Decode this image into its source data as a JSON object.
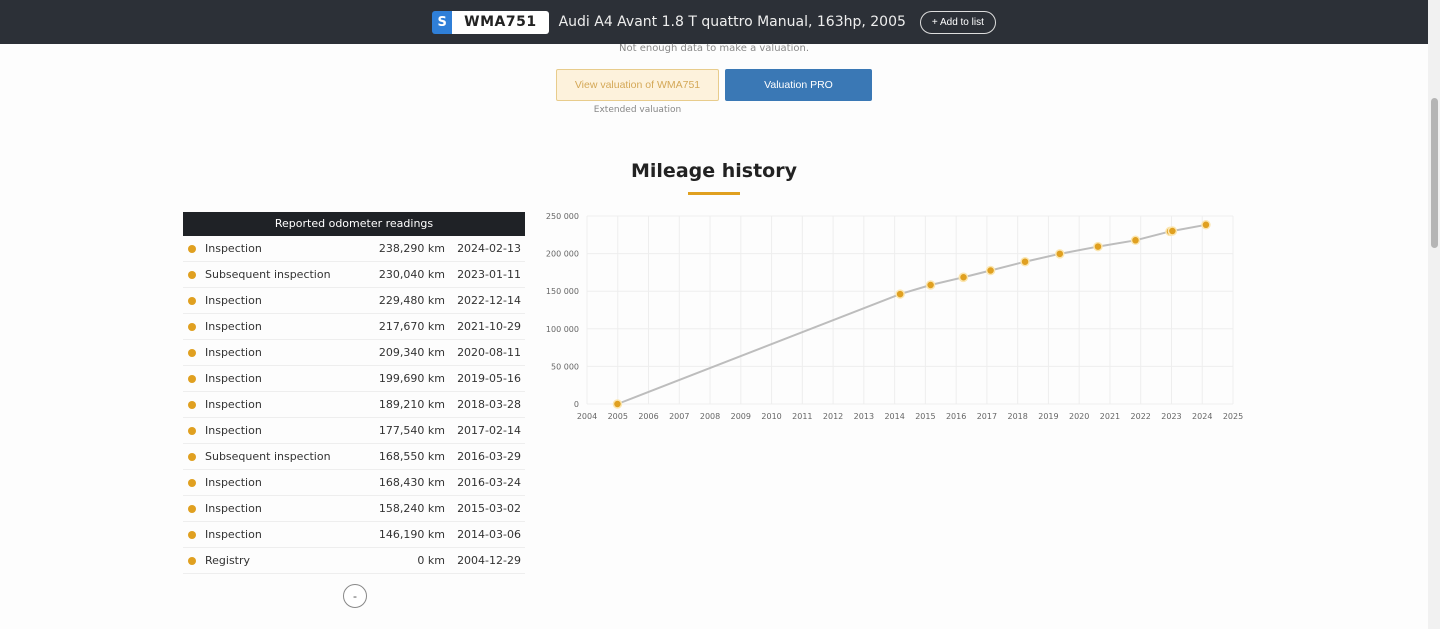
{
  "header": {
    "plate_prefix": "S",
    "plate": "WMA751",
    "title": "Audi A4 Avant 1.8 T quattro Manual, 163hp, 2005",
    "add_to_list": "+ Add to list"
  },
  "valuation": {
    "note": "Not enough data to make a valuation.",
    "view_button": "View valuation of WMA751",
    "pro_button": "Valuation PRO",
    "extended": "Extended valuation"
  },
  "section_title": "Mileage history",
  "table": {
    "header": "Reported odometer readings",
    "rows": [
      {
        "type": "Inspection",
        "km": "238,290 km",
        "date": "2024-02-13"
      },
      {
        "type": "Subsequent inspection",
        "km": "230,040 km",
        "date": "2023-01-11"
      },
      {
        "type": "Inspection",
        "km": "229,480 km",
        "date": "2022-12-14"
      },
      {
        "type": "Inspection",
        "km": "217,670 km",
        "date": "2021-10-29"
      },
      {
        "type": "Inspection",
        "km": "209,340 km",
        "date": "2020-08-11"
      },
      {
        "type": "Inspection",
        "km": "199,690 km",
        "date": "2019-05-16"
      },
      {
        "type": "Inspection",
        "km": "189,210 km",
        "date": "2018-03-28"
      },
      {
        "type": "Inspection",
        "km": "177,540 km",
        "date": "2017-02-14"
      },
      {
        "type": "Subsequent inspection",
        "km": "168,550 km",
        "date": "2016-03-29"
      },
      {
        "type": "Inspection",
        "km": "168,430 km",
        "date": "2016-03-24"
      },
      {
        "type": "Inspection",
        "km": "158,240 km",
        "date": "2015-03-02"
      },
      {
        "type": "Inspection",
        "km": "146,190 km",
        "date": "2014-03-06"
      },
      {
        "type": "Registry",
        "km": "0 km",
        "date": "2004-12-29"
      }
    ],
    "collapse": "-"
  },
  "chart_data": {
    "type": "line",
    "xlabel": "",
    "ylabel": "",
    "xlim": [
      2004,
      2025
    ],
    "ylim": [
      0,
      250000
    ],
    "x_ticks": [
      "2004",
      "2005",
      "2006",
      "2007",
      "2008",
      "2009",
      "2010",
      "2011",
      "2012",
      "2013",
      "2014",
      "2015",
      "2016",
      "2017",
      "2018",
      "2019",
      "2020",
      "2021",
      "2022",
      "2023",
      "2024",
      "2025"
    ],
    "y_ticks": [
      "0",
      "50 000",
      "100 000",
      "150 000",
      "200 000",
      "250 000"
    ],
    "points": [
      [
        2004.99,
        0
      ],
      [
        2014.18,
        146190
      ],
      [
        2015.17,
        158240
      ],
      [
        2016.23,
        168430
      ],
      [
        2016.24,
        168550
      ],
      [
        2017.12,
        177540
      ],
      [
        2018.24,
        189210
      ],
      [
        2019.37,
        199690
      ],
      [
        2020.61,
        209340
      ],
      [
        2021.83,
        217670
      ],
      [
        2022.95,
        229480
      ],
      [
        2023.03,
        230040
      ],
      [
        2024.12,
        238290
      ]
    ],
    "line_color": "#bdbdbd",
    "point_color": "#e0a020",
    "grid": true
  }
}
